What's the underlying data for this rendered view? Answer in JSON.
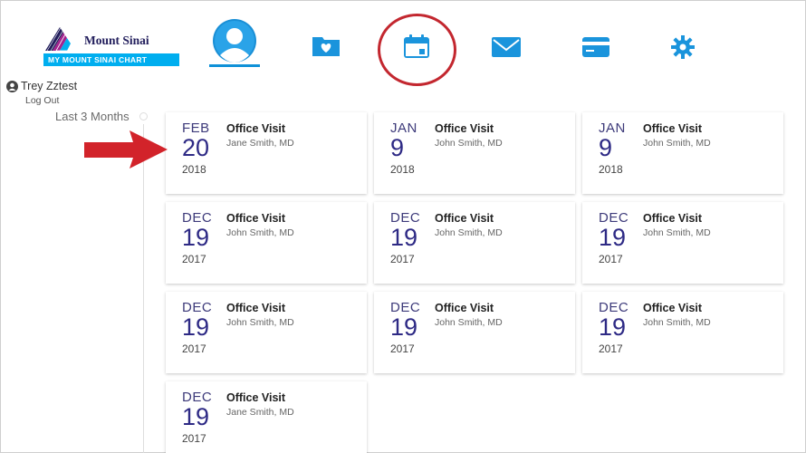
{
  "brand": {
    "name": "Mount Sinai",
    "bar_text": "MY MOUNT SINAI CHART",
    "colors": {
      "navy": "#221e5c",
      "cyan": "#00aeef",
      "magenta": "#a3238e",
      "nav_blue": "#0f91d8",
      "highlight": "#c3272f"
    }
  },
  "nav": [
    {
      "icon": "avatar-icon",
      "active": true
    },
    {
      "icon": "folder-heart-icon",
      "active": false
    },
    {
      "icon": "calendar-icon",
      "active": false
    },
    {
      "icon": "mail-icon",
      "active": false
    },
    {
      "icon": "credit-card-icon",
      "active": false
    },
    {
      "icon": "gear-icon",
      "active": false
    }
  ],
  "user": {
    "name": "Trey Zztest",
    "logout": "Log Out"
  },
  "filter": {
    "label": "Last 3 Months"
  },
  "visits": [
    {
      "month": "FEB",
      "day": "20",
      "year": "2018",
      "type": "Office Visit",
      "provider": "Jane Smith, MD"
    },
    {
      "month": "JAN",
      "day": "9",
      "year": "2018",
      "type": "Office Visit",
      "provider": "John Smith, MD"
    },
    {
      "month": "JAN",
      "day": "9",
      "year": "2018",
      "type": "Office Visit",
      "provider": "John Smith, MD"
    },
    {
      "month": "DEC",
      "day": "19",
      "year": "2017",
      "type": "Office Visit",
      "provider": "John Smith, MD"
    },
    {
      "month": "DEC",
      "day": "19",
      "year": "2017",
      "type": "Office Visit",
      "provider": "John Smith, MD"
    },
    {
      "month": "DEC",
      "day": "19",
      "year": "2017",
      "type": "Office Visit",
      "provider": "John Smith, MD"
    },
    {
      "month": "DEC",
      "day": "19",
      "year": "2017",
      "type": "Office Visit",
      "provider": "John Smith, MD"
    },
    {
      "month": "DEC",
      "day": "19",
      "year": "2017",
      "type": "Office Visit",
      "provider": "John Smith, MD"
    },
    {
      "month": "DEC",
      "day": "19",
      "year": "2017",
      "type": "Office Visit",
      "provider": "John Smith, MD"
    },
    {
      "month": "DEC",
      "day": "19",
      "year": "2017",
      "type": "Office Visit",
      "provider": "Jane Smith, MD"
    }
  ]
}
